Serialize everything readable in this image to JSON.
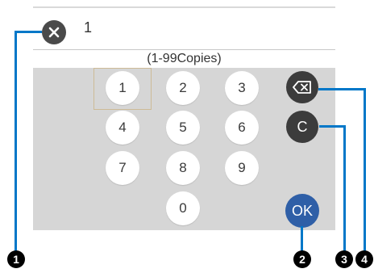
{
  "header": {
    "value": "1"
  },
  "range_label": "(1-99Copies)",
  "keys": {
    "k1": "1",
    "k2": "2",
    "k3": "3",
    "k4": "4",
    "k5": "5",
    "k6": "6",
    "k7": "7",
    "k8": "8",
    "k9": "9",
    "k0": "0"
  },
  "buttons": {
    "clear": "C",
    "ok": "OK"
  },
  "callouts": {
    "c1": "1",
    "c2": "2",
    "c3": "3",
    "c4": "4"
  },
  "colors": {
    "callout": "#0077c8",
    "ok": "#2f5fa7",
    "dark_button": "#3c3c3c",
    "keypad_bg": "#d6d6d6"
  }
}
